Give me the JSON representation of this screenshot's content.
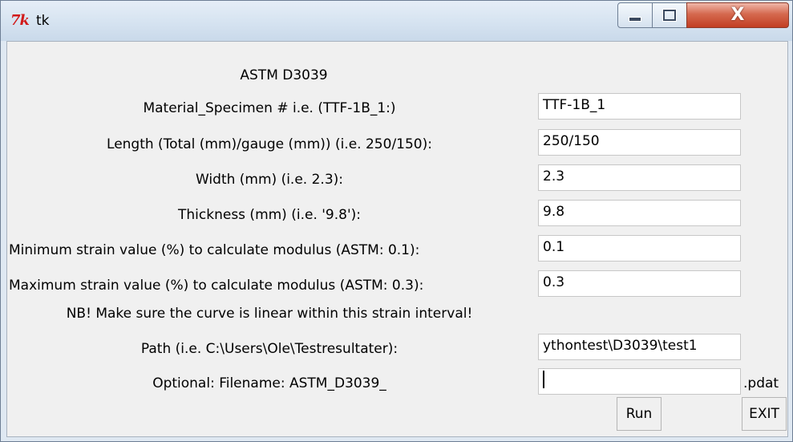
{
  "window": {
    "title": "tk",
    "icon": "tk-feather-icon",
    "controls": {
      "minimize": "minimize-icon",
      "maximize": "maximize-icon",
      "close": "X"
    }
  },
  "form": {
    "heading": "ASTM D3039",
    "material_label": "Material_Specimen # i.e. (TTF-1B_1:)",
    "material_value": "TTF-1B_1",
    "length_label": "Length (Total (mm)/gauge (mm)) (i.e. 250/150):",
    "length_value": "250/150",
    "width_label": "Width (mm) (i.e. 2.3):",
    "width_value": "2.3",
    "thickness_label": "Thickness (mm) (i.e. '9.8'):",
    "thickness_value": "9.8",
    "min_strain_label": "Minimum strain value (%) to calculate modulus (ASTM: 0.1):",
    "min_strain_value": "0.1",
    "max_strain_label": "Maximum strain value (%) to calculate modulus (ASTM: 0.3):",
    "max_strain_value": "0.3",
    "note": "NB! Make sure the curve is linear within this strain interval!",
    "path_label": "Path (i.e. C:\\Users\\Ole\\Testresultater):",
    "path_value": "ythontest\\D3039\\test1",
    "filename_label": "Optional: Filename: ASTM_D3039_",
    "filename_value": "",
    "filename_suffix": ".pdat",
    "run_label": "Run",
    "exit_label": "EXIT"
  }
}
